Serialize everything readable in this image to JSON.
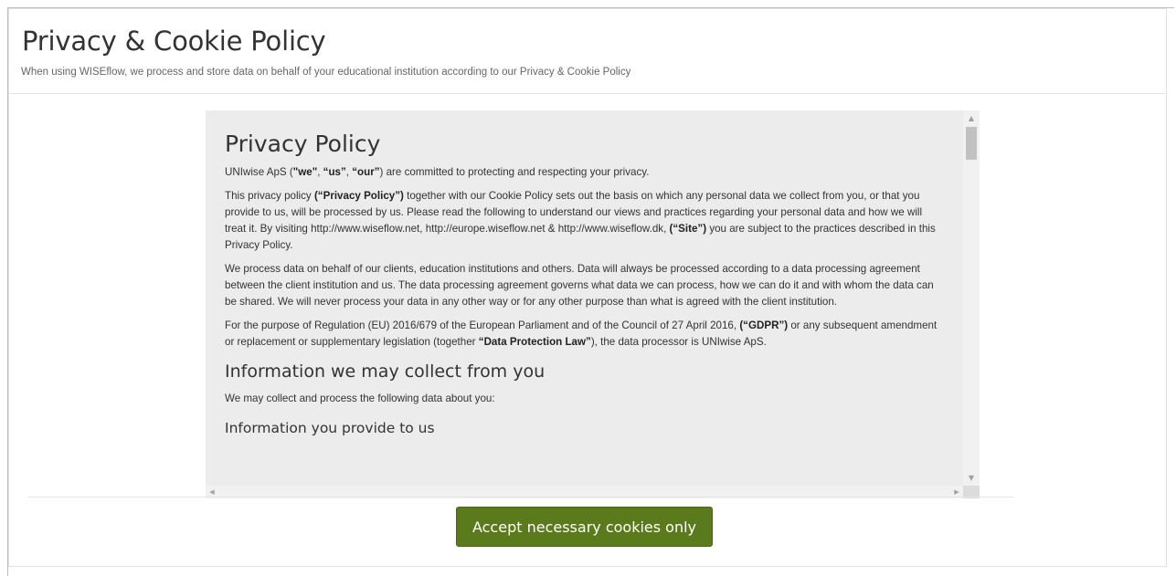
{
  "header": {
    "title": "Privacy & Cookie Policy",
    "subtitle": "When using WISEflow, we process and store data on behalf of your educational institution according to our Privacy & Cookie Policy"
  },
  "policy": {
    "heading": "Privacy Policy",
    "p1": {
      "a": "UNIwise ApS (",
      "b1": "\"we\"",
      "c": ", ",
      "b2": "“us”",
      "d": ", ",
      "b3": "“our”",
      "e": ") are committed to protecting and respecting your privacy."
    },
    "p2": {
      "a": "This privacy policy ",
      "b1": "(“Privacy Policy”)",
      "c": " together with our Cookie Policy sets out the basis on which any personal data we collect from you, or that you provide to us, will be processed by us. Please read the following to understand our views and practices regarding your personal data and how we will treat it. By visiting http://www.wiseflow.net, http://europe.wiseflow.net & http://www.wiseflow.dk, ",
      "b2": "(“Site”)",
      "d": " you are subject to the practices described in this Privacy Policy."
    },
    "p3": "We process data on behalf of our clients, education institutions and others. Data will always be processed according to a data processing agreement between the client institution and us. The data processing agreement governs what data we can process, how we can do it and with whom the data can be shared. We will never process your data in any other way or for any other purpose than what is agreed with the client institution.",
    "p4": {
      "a": "For the purpose of Regulation (EU) 2016/679 of the European Parliament and of the Council of 27 April 2016, ",
      "b1": "(“GDPR”)",
      "c": " or any subsequent amendment or replacement or supplementary legislation (together ",
      "b2": "“Data Protection Law”",
      "d": "), the data processor is UNIwise ApS."
    },
    "section_heading": "Information we may collect from you",
    "p5": "We may collect and process the following data about you:",
    "subsection_heading": "Information you provide to us"
  },
  "scrollbar": {
    "up_glyph": "▲",
    "down_glyph": "▼",
    "left_glyph": "◀",
    "right_glyph": "▶"
  },
  "footer": {
    "accept_label": "Accept necessary cookies only"
  },
  "colors": {
    "button_bg": "#5b7a1c",
    "policy_bg": "#ececec",
    "text": "#333333"
  }
}
